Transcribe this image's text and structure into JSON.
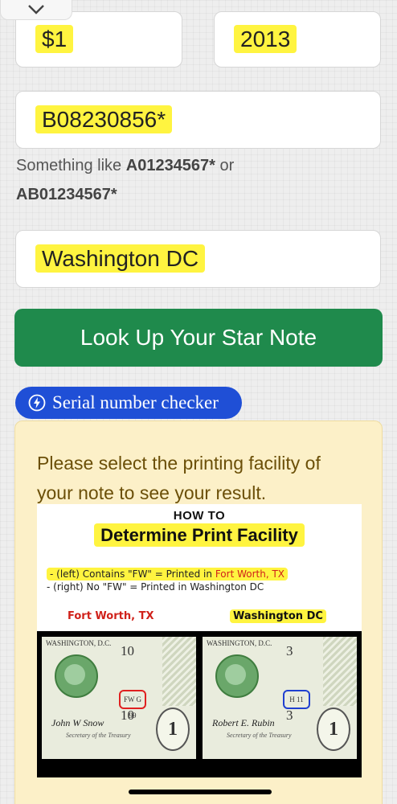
{
  "form": {
    "denomination": "$1",
    "year": "2013",
    "serial": "B08230856*",
    "hint_prefix": "Something like",
    "hint_example1": "A01234567*",
    "hint_or": "or",
    "hint_example2": "AB01234567*",
    "facility": "Washington DC"
  },
  "buttons": {
    "lookup": "Look Up Your Star Note",
    "checker": "Serial number checker"
  },
  "result": {
    "message": "Please select the printing facility of your note to see your result."
  },
  "guide": {
    "title_small": "HOW TO",
    "title_large": "Determine Print Facility",
    "note1_prefix": "- (left) Contains \"FW\" = Printed in",
    "note1_place": "Fort Worth, TX",
    "note2": "- (right) No \"FW\" = Printed in Washington DC",
    "caption_left": "Fort Worth, TX",
    "caption_right": "Washington DC",
    "bill_left": {
      "bank": "WASHINGTON, D.C.",
      "number": "10",
      "code": "FW G 99",
      "signature": "John W Snow",
      "denomination": "1",
      "secretary": "Secretary of the Treasury"
    },
    "bill_right": {
      "bank": "WASHINGTON, D.C.",
      "number": "3",
      "code": "H 11",
      "signature": "Robert E. Rubin",
      "denomination": "1",
      "secretary": "Secretary of the Treasury"
    }
  },
  "colors": {
    "green_button": "#1f8a4c",
    "blue_button": "#1f4fd6",
    "result_bg": "#fcf0c8",
    "result_text": "#6b4f08",
    "highlight": "#fff000",
    "fort_worth_red": "#d0211a"
  },
  "icons": {
    "collapse": "chevron-down-icon",
    "checker": "lightning-icon"
  }
}
